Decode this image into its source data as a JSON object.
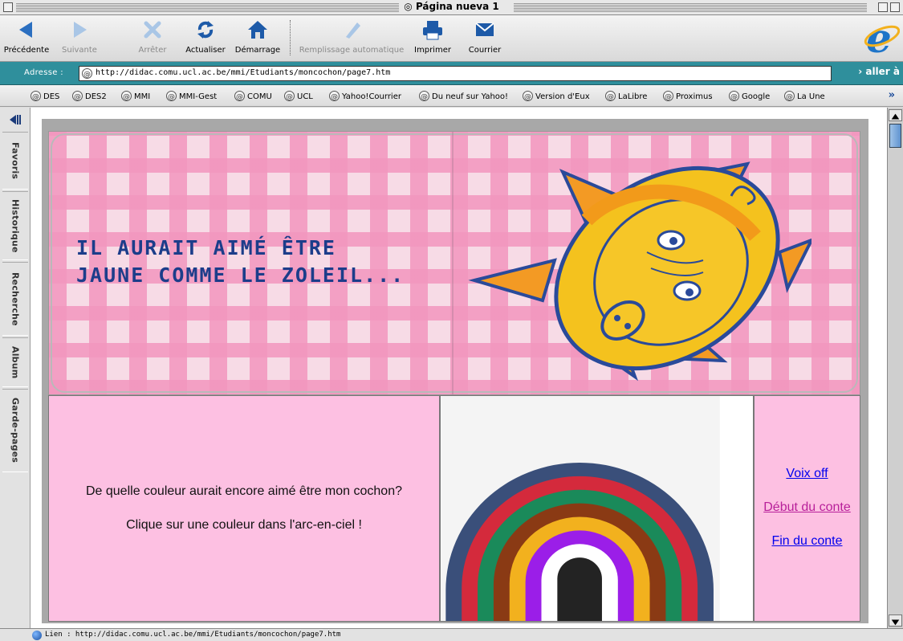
{
  "window": {
    "title": "Página nueva 1"
  },
  "toolbar": {
    "back": "Précédente",
    "forward": "Suivante",
    "stop": "Arrêter",
    "refresh": "Actualiser",
    "home": "Démarrage",
    "autofill": "Remplissage automatique",
    "print": "Imprimer",
    "mail": "Courrier"
  },
  "address": {
    "label": "Adresse :",
    "url": "http://didac.comu.ucl.ac.be/mmi/Etudiants/moncochon/page7.htm",
    "go": "› aller à"
  },
  "favorites": [
    "DES",
    "DES2",
    "MMI",
    "MMI-Gest",
    "COMU",
    "UCL",
    "Yahoo!Courrier",
    "Du neuf sur Yahoo!",
    "Version d'Eux",
    "LaLibre",
    "Proximus",
    "Google",
    "La Une"
  ],
  "sidebar": {
    "tabs": [
      "Favoris",
      "Historique",
      "Recherche",
      "Album",
      "Garde-pages"
    ]
  },
  "banner": {
    "line1": "IL AURAIT AIMÉ ÊTRE",
    "line2": "JAUNE COMME LE ZOLEIL..."
  },
  "page": {
    "question": "De quelle couleur aurait encore aimé être mon cochon?",
    "instruction": "Clique sur une couleur dans l'arc-en-ciel !"
  },
  "links": {
    "voice": "Voix off",
    "start": "Début du conte",
    "end": "Fin du conte"
  },
  "rainbow_colors": [
    "#3a4f7a",
    "#d42a3c",
    "#1a8a5a",
    "#8a3a14",
    "#f2b11e",
    "#9b1ee8",
    "#ffffff",
    "#232323"
  ],
  "link_colors": {
    "unvisited": "#0000ee",
    "visited": "#b8209a"
  },
  "status": {
    "text": "Lien  : http://didac.comu.ucl.ac.be/mmi/Etudiants/moncochon/page7.htm"
  }
}
